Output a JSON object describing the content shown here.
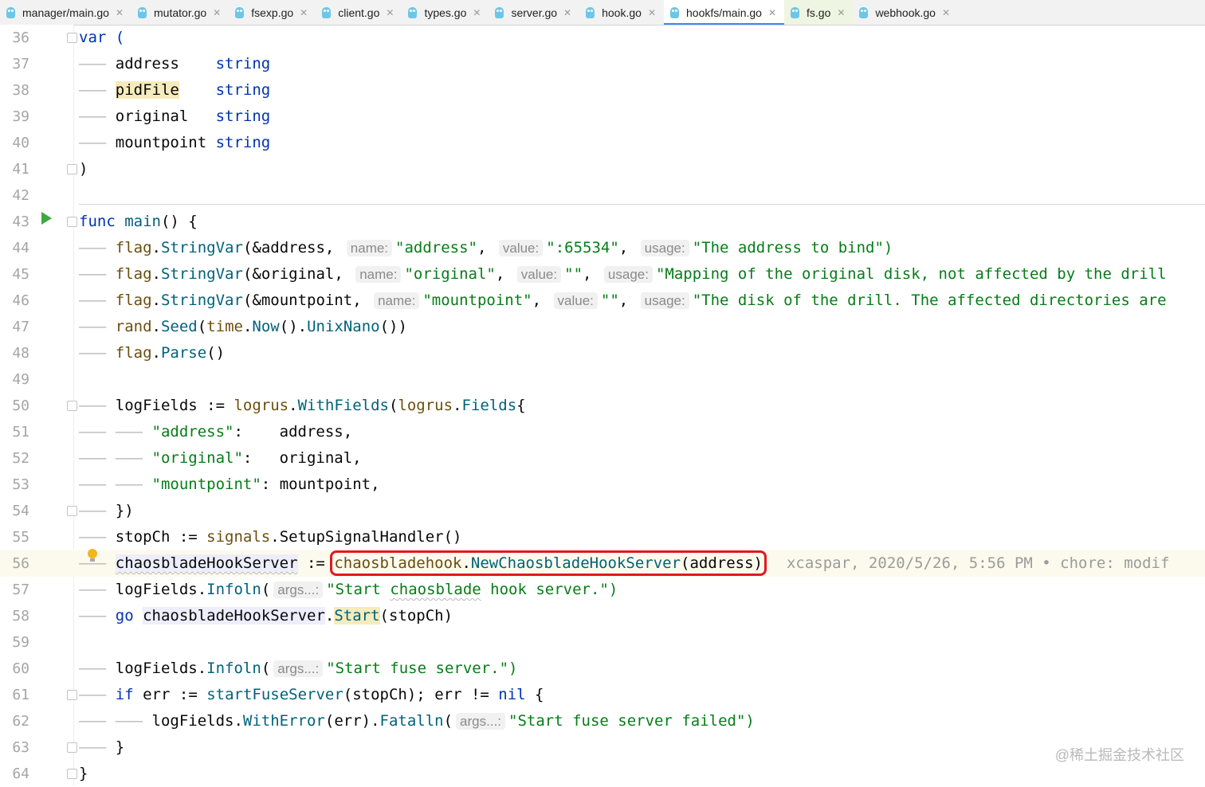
{
  "tabs": [
    {
      "label": "manager/main.go",
      "active": false
    },
    {
      "label": "mutator.go",
      "active": false
    },
    {
      "label": "fsexp.go",
      "active": false
    },
    {
      "label": "client.go",
      "active": false
    },
    {
      "label": "types.go",
      "active": false
    },
    {
      "label": "server.go",
      "active": false
    },
    {
      "label": "hook.go",
      "active": false
    },
    {
      "label": "hookfs/main.go",
      "active": true
    },
    {
      "label": "fs.go",
      "active": false
    },
    {
      "label": "webhook.go",
      "active": false
    }
  ],
  "close_glyph": "✕",
  "line_numbers": [
    "36",
    "37",
    "38",
    "39",
    "40",
    "41",
    "42",
    "43",
    "44",
    "45",
    "46",
    "47",
    "48",
    "49",
    "50",
    "51",
    "52",
    "53",
    "54",
    "55",
    "56",
    "57",
    "58",
    "59",
    "60",
    "61",
    "62",
    "63",
    "64"
  ],
  "code": {
    "l36": "var (",
    "l37_a": "address",
    "l37_b": "string",
    "l38_a": "pidFile",
    "l38_b": "string",
    "l39_a": "original",
    "l39_b": "string",
    "l40_a": "mountpoint",
    "l40_b": "string",
    "l41": ")",
    "l43_kw": "func",
    "l43_fn": "main",
    "l43_rest": "() {",
    "flag": "flag",
    "stringvar": "StringVar",
    "hint_name": "name:",
    "hint_value": "value:",
    "hint_usage": "usage:",
    "hint_args": "args...:",
    "l44_ref": "(&address, ",
    "l44_name": "\"address\"",
    "l44_value": "\":65534\"",
    "l44_usage": "\"The address to bind\")",
    "l45_ref": "(&original, ",
    "l45_name": "\"original\"",
    "l45_value": "\"\"",
    "l45_usage": "\"Mapping of the original disk, not affected by the drill",
    "l46_ref": "(&mountpoint, ",
    "l46_name": "\"mountpoint\"",
    "l46_value": "\"\"",
    "l46_usage": "\"The disk of the drill. The affected directories are",
    "l47_rand": "rand",
    "l47_seed": "Seed",
    "l47_time": "time",
    "l47_now": "Now",
    "l47_unix": "UnixNano",
    "l47_end": "())",
    "l48_parse": "Parse",
    "l48_end": "()",
    "l50_var": "logFields",
    "l50_op": " := ",
    "l50_logrus": "logrus",
    "l50_with": "WithFields",
    "l50_fields": "Fields",
    "l50_end": "{",
    "l51_key": "\"address\"",
    "l51_val": "address,",
    "l52_key": "\"original\"",
    "l52_val": "original,",
    "l53_key": "\"mountpoint\"",
    "l53_val": "mountpoint,",
    "l54": "})",
    "l55_var": "stopCh",
    "l55_op": " := ",
    "l55_pkg": "signals",
    "l55_fn": "SetupSignalHandler",
    "l55_end": "()",
    "l56_var": "chaosbladeHookServer",
    "l56_op": " := ",
    "l56_pkg": "chaosbladehook",
    "l56_fn": "NewChaosbladeHookServer",
    "l56_arg": "(address)",
    "l56_blame": "xcaspar, 2020/5/26, 5:56 PM • chore: modif",
    "l57_var": "logFields",
    "l57_fn": "Infoln",
    "l57_str_a": "\"Start ",
    "l57_str_b": "chaosblade",
    "l57_str_c": " hook server.\")",
    "l58_kw": "go",
    "l58_var": "chaosbladeHookServer",
    "l58_fn": "Start",
    "l58_arg": "(stopCh)",
    "l60_str": "\"Start fuse server.\")",
    "l61_if": "if",
    "l61_err": "err",
    "l61_op": " := ",
    "l61_fn": "startFuseServer",
    "l61_arg": "(stopCh); ",
    "l61_neq": " != ",
    "l61_nil": "nil",
    "l61_end": " {",
    "l62_var": "logFields",
    "l62_with": "WithError",
    "l62_arg": "(err).",
    "l62_fatal": "Fatalln",
    "l62_str": "\"Start fuse server failed\")",
    "l63": "}",
    "l64": "}"
  },
  "watermark": "@稀土掘金技术社区"
}
